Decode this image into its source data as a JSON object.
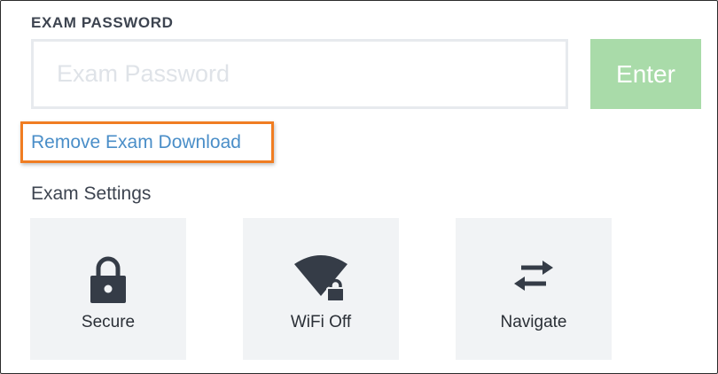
{
  "password_section": {
    "label": "EXAM PASSWORD",
    "placeholder": "Exam Password",
    "value": "",
    "enter_label": "Enter",
    "enter_color": "#a9dba9"
  },
  "remove_link": {
    "label": "Remove Exam Download",
    "color": "#4a8ec8",
    "highlight_color": "#f07d22"
  },
  "settings": {
    "title": "Exam Settings",
    "tiles": [
      {
        "label": "Secure",
        "icon": "lock-icon"
      },
      {
        "label": "WiFi Off",
        "icon": "wifi-off-lock-icon"
      },
      {
        "label": "Navigate",
        "icon": "swap-arrows-icon"
      }
    ]
  }
}
